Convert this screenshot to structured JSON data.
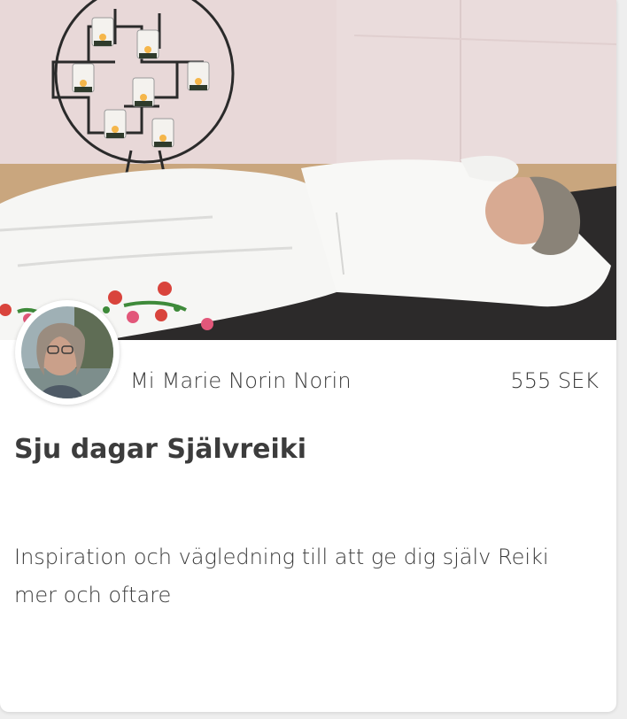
{
  "course": {
    "image_alt": "Woman lying on a yoga mat in white clothes in front of a candle holder",
    "author_name": "Mi Marie Norin Norin",
    "price": "555 SEK",
    "title": "Sju dagar Självreiki",
    "description": "Inspiration och vägledning till att ge dig själv Reiki mer och oftare"
  },
  "colors": {
    "card_background": "#ffffff",
    "page_background": "#eeeeee",
    "text": "#3a3a3a",
    "title": "#3c3c3c",
    "wall": "#e7d6d6",
    "floor": "#c8a57d",
    "mat": "#2b2b2b"
  }
}
